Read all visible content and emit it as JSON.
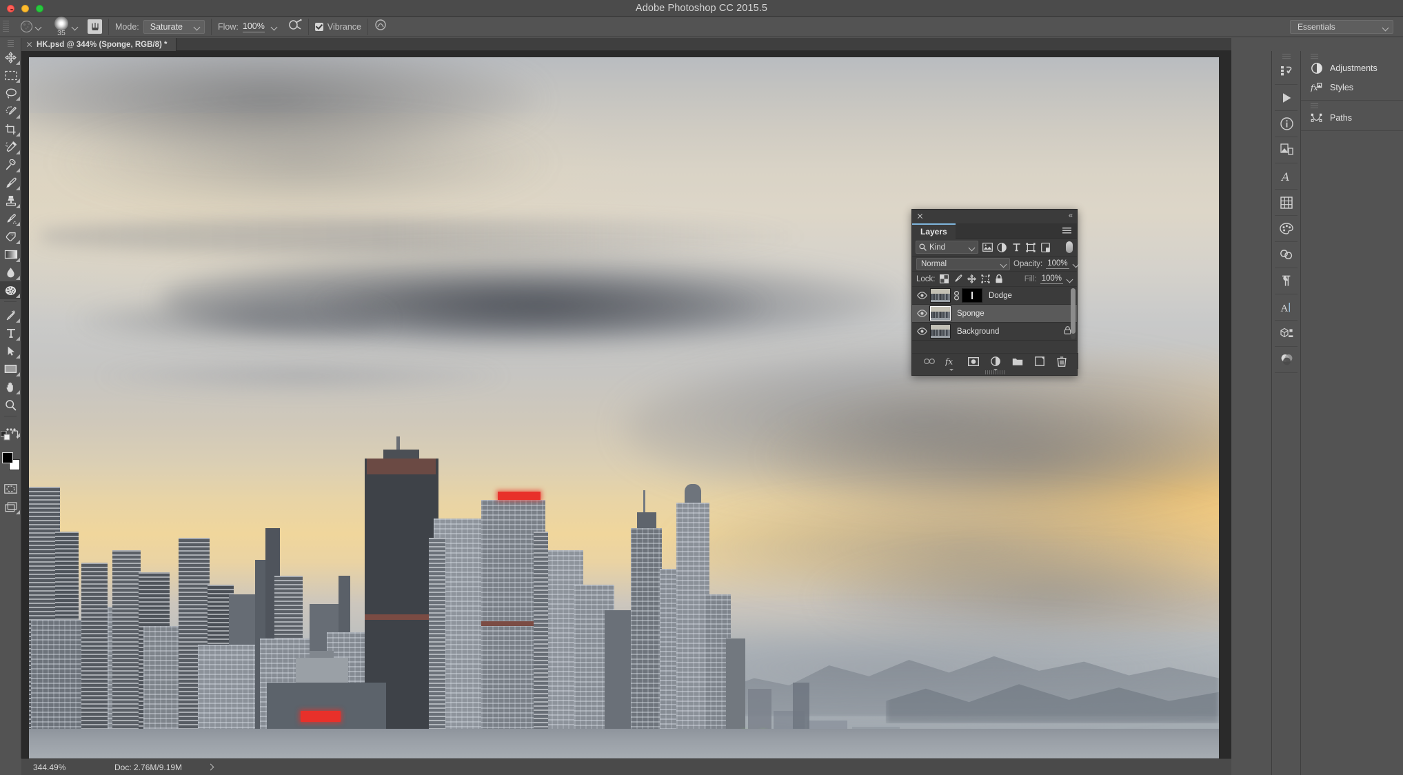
{
  "window": {
    "app_title": "Adobe Photoshop CC 2015.5",
    "traffic_lights": [
      "close",
      "minimize",
      "maximize"
    ]
  },
  "options_bar": {
    "tool_preset_icon": "sponge-brush-icon",
    "brush_size": "35",
    "brush_panel_icon": "brush-panel-icon",
    "mode_label": "Mode:",
    "mode_value": "Saturate",
    "flow_label": "Flow:",
    "flow_value": "100%",
    "airbrush_icon": "airbrush-icon",
    "vibrance_label": "Vibrance",
    "vibrance_checked": true,
    "workspace_value": "Essentials"
  },
  "document_tab": {
    "title": "HK.psd @ 344% (Sponge, RGB/8) *",
    "close_icon": "close-icon"
  },
  "toolbar": {
    "tools": [
      {
        "name": "move-tool",
        "icon": "move-icon",
        "selected": false,
        "has_flyout": true
      },
      {
        "name": "rectangular-marquee-tool",
        "icon": "marquee-icon",
        "selected": false,
        "has_flyout": true
      },
      {
        "name": "lasso-tool",
        "icon": "lasso-icon",
        "selected": false,
        "has_flyout": true
      },
      {
        "name": "quick-selection-tool",
        "icon": "quick-selection-icon",
        "selected": false,
        "has_flyout": true
      },
      {
        "name": "crop-tool",
        "icon": "crop-icon",
        "selected": false,
        "has_flyout": true
      },
      {
        "name": "eyedropper-tool",
        "icon": "eyedropper-icon",
        "selected": false,
        "has_flyout": true
      },
      {
        "name": "spot-healing-brush-tool",
        "icon": "healing-brush-icon",
        "selected": false,
        "has_flyout": true
      },
      {
        "name": "brush-tool",
        "icon": "brush-icon",
        "selected": false,
        "has_flyout": true
      },
      {
        "name": "clone-stamp-tool",
        "icon": "clone-stamp-icon",
        "selected": false,
        "has_flyout": true
      },
      {
        "name": "history-brush-tool",
        "icon": "history-brush-icon",
        "selected": false,
        "has_flyout": true
      },
      {
        "name": "eraser-tool",
        "icon": "eraser-icon",
        "selected": false,
        "has_flyout": true
      },
      {
        "name": "gradient-tool",
        "icon": "gradient-icon",
        "selected": false,
        "has_flyout": true
      },
      {
        "name": "blur-tool",
        "icon": "blur-droplet-icon",
        "selected": false,
        "has_flyout": true
      },
      {
        "name": "sponge-tool",
        "icon": "sponge-icon",
        "selected": true,
        "has_flyout": true
      },
      {
        "name": "pen-tool",
        "icon": "pen-icon",
        "selected": false,
        "has_flyout": true
      },
      {
        "name": "horizontal-type-tool",
        "icon": "type-icon",
        "selected": false,
        "has_flyout": true
      },
      {
        "name": "path-selection-tool",
        "icon": "path-arrow-icon",
        "selected": false,
        "has_flyout": true
      },
      {
        "name": "rectangle-tool",
        "icon": "rectangle-shape-icon",
        "selected": false,
        "has_flyout": true
      },
      {
        "name": "hand-tool",
        "icon": "hand-icon",
        "selected": false,
        "has_flyout": true
      },
      {
        "name": "zoom-tool",
        "icon": "magnifier-icon",
        "selected": false,
        "has_flyout": false
      },
      {
        "name": "edit-toolbar-more",
        "icon": "ellipsis-icon",
        "selected": false,
        "has_flyout": true
      }
    ],
    "default_colors_icon": "default-colors-icon",
    "swap_colors_icon": "swap-colors-icon",
    "foreground_color": "#000000",
    "background_color": "#ffffff",
    "quick_mask_icon": "quick-mask-icon",
    "screen_mode_icon": "screen-mode-icon"
  },
  "layers_panel": {
    "close_icon": "close-icon",
    "collapse_icon": "collapse-to-icons-icon",
    "tab_label": "Layers",
    "menu_icon": "panel-menu-icon",
    "filter_kind_label": "Kind",
    "filter_search_icon": "search-icon",
    "filter_icons": [
      "pixel-layers-filter-icon",
      "adjustment-layers-filter-icon",
      "type-layers-filter-icon",
      "shape-layers-filter-icon",
      "smart-object-filter-icon"
    ],
    "filter_toggle_icon": "filter-enable-toggle",
    "blend_mode": "Normal",
    "opacity_label": "Opacity:",
    "opacity_value": "100%",
    "lock_label": "Lock:",
    "lock_icons": [
      "lock-transparent-pixels-icon",
      "lock-image-pixels-icon",
      "lock-position-icon",
      "lock-artboard-nesting-icon",
      "lock-all-icon"
    ],
    "fill_label": "Fill:",
    "fill_value": "100%",
    "layers": [
      {
        "name": "Dodge",
        "visible": true,
        "selected": false,
        "has_mask": true,
        "linked": true,
        "locked": false
      },
      {
        "name": "Sponge",
        "visible": true,
        "selected": true,
        "has_mask": false,
        "linked": false,
        "locked": false
      },
      {
        "name": "Background",
        "visible": true,
        "selected": false,
        "has_mask": false,
        "linked": false,
        "locked": true
      }
    ],
    "footer_buttons": [
      {
        "name": "link-layers-button",
        "icon": "link-icon"
      },
      {
        "name": "layer-style-button",
        "icon": "fx-icon"
      },
      {
        "name": "add-layer-mask-button",
        "icon": "layer-mask-icon"
      },
      {
        "name": "new-adjustment-layer-button",
        "icon": "adjustment-half-circle-icon"
      },
      {
        "name": "new-group-button",
        "icon": "folder-icon"
      },
      {
        "name": "new-layer-button",
        "icon": "new-layer-icon"
      },
      {
        "name": "delete-layer-button",
        "icon": "trash-icon"
      }
    ]
  },
  "right_dock": {
    "rail_icons": [
      {
        "name": "history-rail-icon",
        "icon": "history-icon"
      },
      {
        "name": "actions-rail-icon",
        "icon": "play-icon"
      },
      {
        "name": "info-rail-icon",
        "icon": "info-circle-icon"
      },
      {
        "name": "layer-comps-rail-icon",
        "icon": "layer-comps-icon"
      },
      {
        "name": "character-styles-rail-icon",
        "icon": "character-styles-icon"
      },
      {
        "name": "swatches-rail-icon",
        "icon": "grid-icon"
      },
      {
        "name": "color-rail-icon",
        "icon": "palette-icon"
      },
      {
        "name": "libraries-rail-icon",
        "icon": "creative-cloud-icon"
      },
      {
        "name": "paragraph-rail-icon",
        "icon": "paragraph-icon"
      },
      {
        "name": "character-rail-icon",
        "icon": "character-A-icon"
      },
      {
        "name": "3d-rail-icon",
        "icon": "cube-icon"
      },
      {
        "name": "channels-rail-icon",
        "icon": "channels-icon"
      }
    ],
    "panels": [
      {
        "label": "Adjustments",
        "icon": "adjustment-half-circle-icon"
      },
      {
        "label": "Styles",
        "icon": "fx-styles-icon"
      },
      {
        "label": "Paths",
        "icon": "paths-icon"
      }
    ]
  },
  "status_bar": {
    "zoom": "344.49%",
    "doc_size": "Doc: 2.76M/9.19M",
    "expand_icon": "chevron-right-icon"
  },
  "canvas": {
    "scene_description": "Hong Kong harbour skyline at sunset with layered clouds"
  }
}
